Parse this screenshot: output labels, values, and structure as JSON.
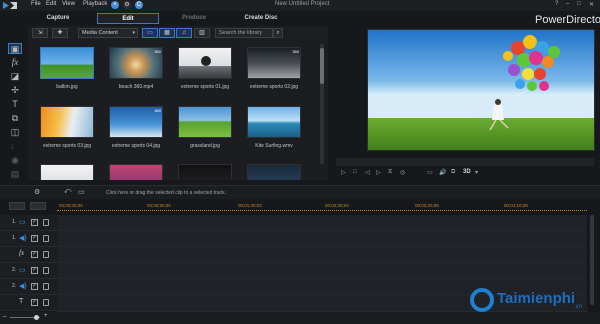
{
  "menubar": {
    "items": [
      "File",
      "Edit",
      "View",
      "Playback"
    ],
    "window_title": "New Untitled Project",
    "win_controls": [
      "?",
      "–",
      "□",
      "✕"
    ]
  },
  "modes": {
    "capture": "Capture",
    "edit": "Edit",
    "produce": "Produce",
    "create_disc": "Create Disc"
  },
  "app_name": "PowerDirector",
  "library": {
    "content_select": "Media Content",
    "search_placeholder": "Search the library",
    "clips": [
      {
        "name": "ballon.jpg"
      },
      {
        "name": "beach 360.mp4",
        "badge": "360"
      },
      {
        "name": "extreme sports 01.jpg"
      },
      {
        "name": "extreme sports 02.jpg",
        "badge": "360"
      },
      {
        "name": "extreme sports 03.jpg"
      },
      {
        "name": "extreme sports 04.jpg",
        "badge": "360"
      },
      {
        "name": "grassland.jpg"
      },
      {
        "name": "Kite Surfing.wmv"
      },
      {
        "name": ""
      },
      {
        "name": ""
      },
      {
        "name": ""
      },
      {
        "name": ""
      }
    ]
  },
  "preview": {
    "controls": [
      "▷",
      "□",
      "◁",
      "▷",
      "⧖",
      "◎",
      "▭",
      "🔊",
      "⧉",
      "3D",
      "▾"
    ]
  },
  "timeline": {
    "hint": "Click here or drag the selected clip to a selected track.",
    "ruler": [
      "00;00;00;00",
      "00;00;50;00",
      "00;01;40;02",
      "00;02;30;04",
      "00;03;20;06",
      "00;04;10;08"
    ],
    "tracks": [
      {
        "num": "1.",
        "type": "video"
      },
      {
        "num": "1.",
        "type": "audio"
      },
      {
        "num": "",
        "type": "fx"
      },
      {
        "num": "2.",
        "type": "video"
      },
      {
        "num": "2.",
        "type": "audio"
      },
      {
        "num": "",
        "type": "title"
      }
    ]
  },
  "watermark": {
    "name": "Taimienphi",
    "suffix": ".vn"
  },
  "colors": {
    "accent": "#3a7bc0",
    "ruler": "#c08a2c",
    "track_icon": "#3a90dd"
  }
}
